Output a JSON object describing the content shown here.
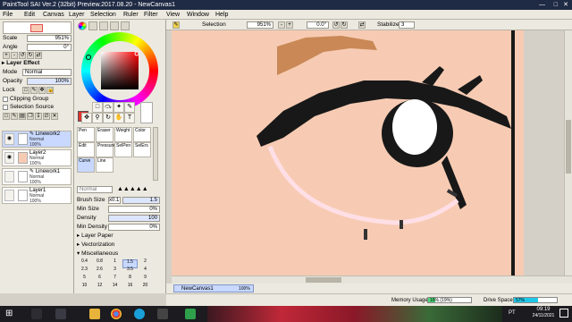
{
  "window": {
    "title": "PaintTool SAI Ver.2 (32bit) Preview.2017.08.20 - NewCanvas1"
  },
  "menu": [
    "File",
    "Edit",
    "Canvas",
    "Layer",
    "Selection",
    "Ruler",
    "Filter",
    "View",
    "Window",
    "Help"
  ],
  "nav": {
    "scale_label": "Scale",
    "scale_value": "951%",
    "angle_label": "Angle",
    "angle_value": "0°"
  },
  "layer_effect": {
    "header": "Layer Effect",
    "mode_label": "Mode",
    "mode_value": "Normal",
    "opacity_label": "Opacity",
    "opacity_value": "100%",
    "lock_label": "Lock",
    "clipping_label": "Clipping Group",
    "selection_source_label": "Selection Source"
  },
  "layers": [
    {
      "name": "Linework2",
      "mode": "Normal",
      "opacity": "100%",
      "selected": true
    },
    {
      "name": "Layer2",
      "mode": "Normal",
      "opacity": "100%",
      "selected": false
    },
    {
      "name": "Linework1",
      "mode": "Normal",
      "opacity": "100%",
      "selected": false
    },
    {
      "name": "Layer1",
      "mode": "Normal",
      "opacity": "100%",
      "selected": false
    }
  ],
  "color": {
    "current": "#e0332e",
    "secondary": "#ffffff"
  },
  "tools": {
    "brushes": [
      {
        "label": "Pen"
      },
      {
        "label": "Eraser"
      },
      {
        "label": "Weight"
      },
      {
        "label": "Color"
      },
      {
        "label": "Edit"
      },
      {
        "label": "Pressure"
      },
      {
        "label": "SelPen"
      },
      {
        "label": "SelErs"
      },
      {
        "label": "Curve"
      },
      {
        "label": "Line"
      }
    ]
  },
  "brush_settings": {
    "mode_value": "Normal",
    "brush_size_label": "Brush Size",
    "brush_size_mult": "x0.1",
    "brush_size_value": "1.5",
    "min_size_label": "Min Size",
    "min_size_value": "0%",
    "density_label": "Density",
    "density_value": "100",
    "min_density_label": "Min Density",
    "min_density_value": "0%",
    "sections": [
      "Layer Paper",
      "Vectorization",
      "Miscellaneous"
    ]
  },
  "size_presets": [
    "0.4",
    "0.8",
    "1",
    "1.5",
    "2",
    "2.3",
    "2.6",
    "3",
    "3.5",
    "4",
    "5",
    "6",
    "7",
    "8",
    "9",
    "10",
    "12",
    "14",
    "16",
    "20"
  ],
  "toolbar": {
    "selection_label": "Selection",
    "zoom_value": "951%",
    "angle_value": "0.0°",
    "stabilizer_label": "Stabilizer",
    "stabilizer_value": "3"
  },
  "doc_tabs": [
    {
      "name": "NewCanvas1",
      "zoom": "100%"
    }
  ],
  "status": {
    "memory_label": "Memory Usage",
    "memory_value": "16% (19%)",
    "memory_fill": 0.16,
    "drive_label": "Drive Space",
    "drive_value": "57%",
    "drive_fill": 0.57
  },
  "taskbar": {
    "locale": "PT",
    "time": "09:19",
    "date": "24/11/2021",
    "apps": [
      "search",
      "file-explorer",
      "chrome",
      "edge",
      "store",
      "mail",
      "paint-tool-sai"
    ]
  }
}
